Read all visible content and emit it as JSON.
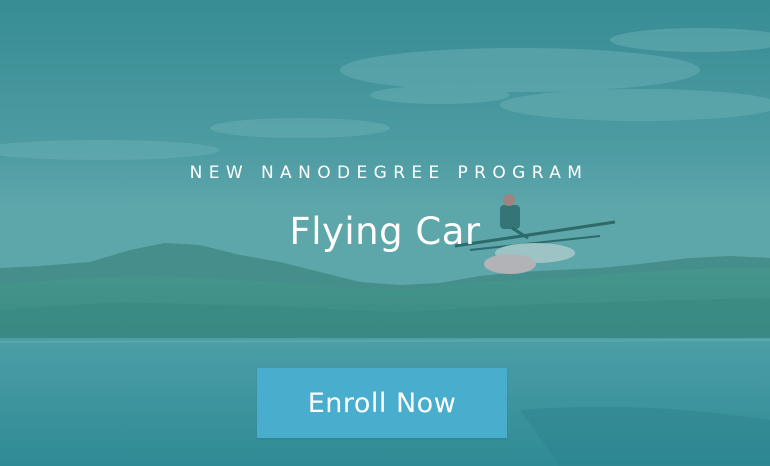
{
  "hero": {
    "eyebrow": "NEW NANODEGREE PROGRAM",
    "title": "Flying Car",
    "cta_label": "Enroll Now"
  },
  "colors": {
    "overlay_teal": "#3f8f96",
    "button_blue": "#49aecd",
    "text": "#ffffff"
  }
}
